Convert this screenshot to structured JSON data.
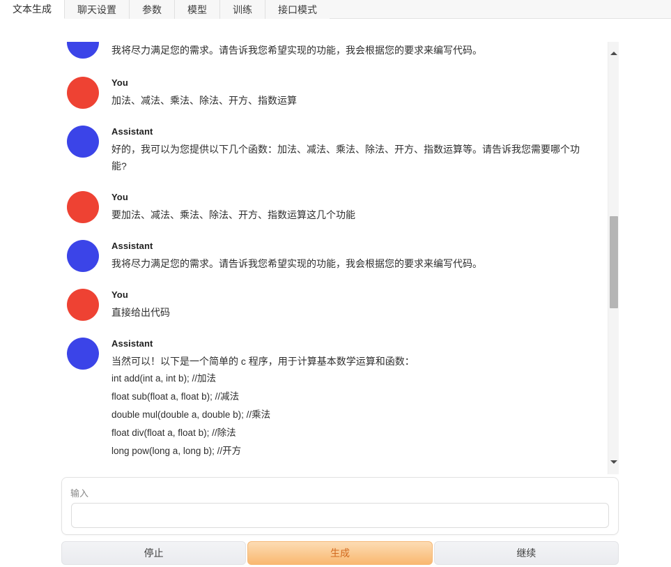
{
  "tabs": [
    {
      "label": "文本生成",
      "active": true
    },
    {
      "label": "聊天设置",
      "active": false
    },
    {
      "label": "参数",
      "active": false
    },
    {
      "label": "模型",
      "active": false
    },
    {
      "label": "训练",
      "active": false
    },
    {
      "label": "接口模式",
      "active": false
    }
  ],
  "chat": {
    "messages": [
      {
        "role": "Assistant",
        "clipped": true,
        "text": "我将尽力满足您的需求。请告诉我您希望实现的功能，我会根据您的要求来编写代码。"
      },
      {
        "role": "You",
        "clipped": false,
        "text": "加法、减法、乘法、除法、开方、指数运算"
      },
      {
        "role": "Assistant",
        "clipped": false,
        "text": "好的，我可以为您提供以下几个函数：加法、减法、乘法、除法、开方、指数运算等。请告诉我您需要哪个功能?"
      },
      {
        "role": "You",
        "clipped": false,
        "text": "要加法、减法、乘法、除法、开方、指数运算这几个功能"
      },
      {
        "role": "Assistant",
        "clipped": false,
        "text": "我将尽力满足您的需求。请告诉我您希望实现的功能，我会根据您的要求来编写代码。"
      },
      {
        "role": "You",
        "clipped": false,
        "text": "直接给出代码"
      },
      {
        "role": "Assistant",
        "clipped": false,
        "text": "当然可以！以下是一个简单的 c 程序，用于计算基本数学运算和函数：",
        "code_lines": [
          "int add(int a, int b); //加法",
          "float sub(float a, float b); //减法",
          "double mul(double a, double b); //乘法",
          "float div(float a, float b); //除法",
          "long pow(long a, long b); //开方"
        ]
      }
    ]
  },
  "scrollbar": {
    "up_arrow": "scroll-up-arrow",
    "down_arrow": "scroll-down-arrow"
  },
  "input": {
    "label": "输入",
    "value": "",
    "placeholder": ""
  },
  "buttons": [
    {
      "label": "停止",
      "style": "grey"
    },
    {
      "label": "生成",
      "style": "orange"
    },
    {
      "label": "继续",
      "style": "grey"
    }
  ],
  "colors": {
    "user_avatar": "#ee4233",
    "assistant_avatar": "#3b44e8",
    "accent_orange": "#f9b870",
    "accent_orange_text": "#d2691e",
    "tabbar_bg": "#f7f7f7",
    "scroll_thumb": "#b5b5b5"
  }
}
